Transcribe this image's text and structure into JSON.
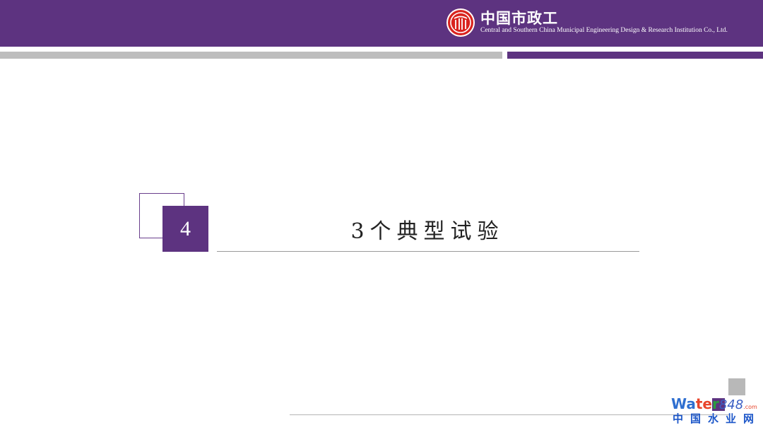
{
  "header": {
    "logo_cn": "中国市政工",
    "logo_en": "Central and Southern China Municipal Engineering Design & Research Institution Co., Ltd."
  },
  "section": {
    "number": "4",
    "title": "3个典型试验"
  },
  "watermark": {
    "part1": "Wa",
    "part2": "te",
    "part3": "r",
    "part4": "848",
    "part5": ".com",
    "cn": "中国水业网"
  },
  "colors": {
    "brand_purple": "#5d3380",
    "divider_gray": "#bdbdbd",
    "logo_red": "#d9231e"
  }
}
